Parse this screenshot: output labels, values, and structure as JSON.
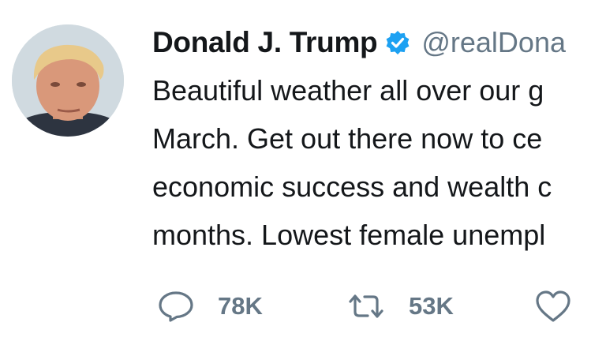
{
  "tweet": {
    "author": {
      "display_name": "Donald J. Trump",
      "handle": "@realDona",
      "verified": true,
      "verified_color": "#1da1f2"
    },
    "text_lines": [
      "Beautiful weather all over our g",
      "March. Get out there now to ce",
      "economic success and wealth c",
      "months. Lowest female unempl"
    ],
    "actions": {
      "reply": {
        "icon": "reply-icon",
        "count": "78K"
      },
      "retweet": {
        "icon": "retweet-icon",
        "count": "53K"
      },
      "like": {
        "icon": "heart-icon",
        "count": ""
      }
    }
  }
}
